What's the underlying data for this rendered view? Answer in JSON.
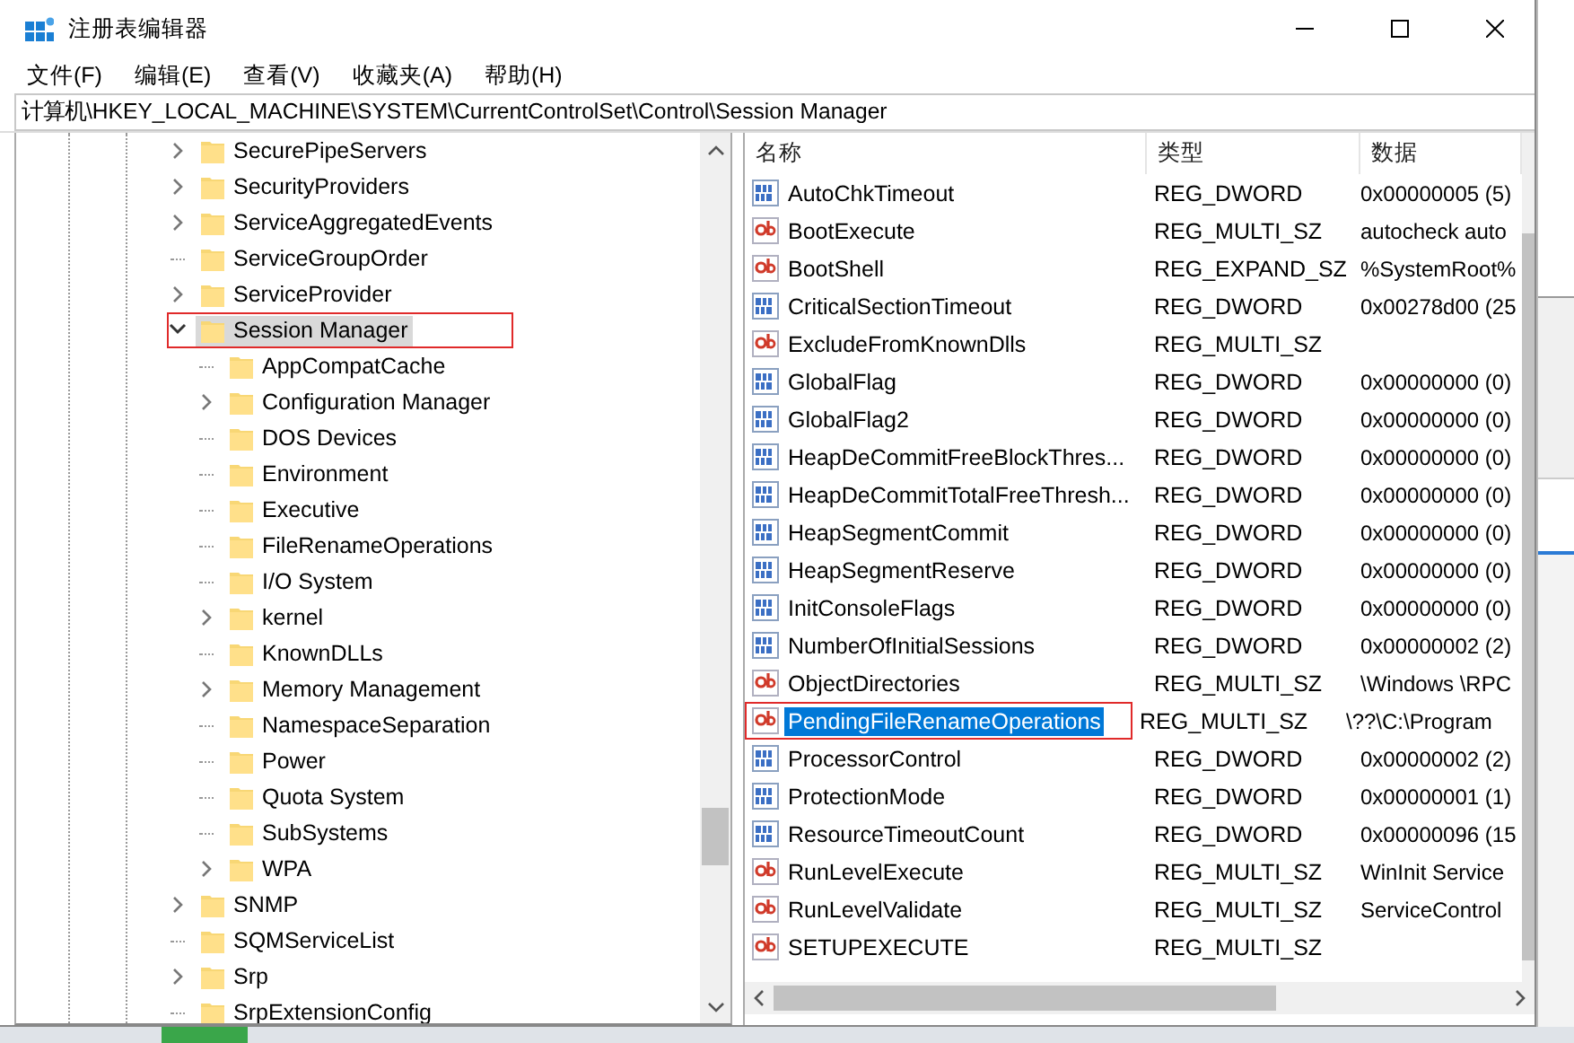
{
  "window": {
    "title": "注册表编辑器"
  },
  "menu": [
    "文件(F)",
    "编辑(E)",
    "查看(V)",
    "收藏夹(A)",
    "帮助(H)"
  ],
  "address_bar": {
    "value": "计算机\\HKEY_LOCAL_MACHINE\\SYSTEM\\CurrentControlSet\\Control\\Session Manager"
  },
  "tree": {
    "items": [
      {
        "label": "SecurePipeServers",
        "expandable": true,
        "expanded": false,
        "selected": false,
        "annotated": false
      },
      {
        "label": "SecurityProviders",
        "expandable": true,
        "expanded": false,
        "selected": false,
        "annotated": false
      },
      {
        "label": "ServiceAggregatedEvents",
        "expandable": true,
        "expanded": false,
        "selected": false,
        "annotated": false
      },
      {
        "label": "ServiceGroupOrder",
        "expandable": false,
        "expanded": false,
        "selected": false,
        "annotated": false
      },
      {
        "label": "ServiceProvider",
        "expandable": true,
        "expanded": false,
        "selected": false,
        "annotated": false
      },
      {
        "label": "Session Manager",
        "expandable": true,
        "expanded": true,
        "selected": true,
        "annotated": true,
        "children": [
          {
            "label": "AppCompatCache",
            "expandable": false,
            "expanded": false,
            "selected": false,
            "annotated": false
          },
          {
            "label": "Configuration Manager",
            "expandable": true,
            "expanded": false,
            "selected": false,
            "annotated": false
          },
          {
            "label": "DOS Devices",
            "expandable": false,
            "expanded": false,
            "selected": false,
            "annotated": false
          },
          {
            "label": "Environment",
            "expandable": false,
            "expanded": false,
            "selected": false,
            "annotated": false
          },
          {
            "label": "Executive",
            "expandable": false,
            "expanded": false,
            "selected": false,
            "annotated": false
          },
          {
            "label": "FileRenameOperations",
            "expandable": false,
            "expanded": false,
            "selected": false,
            "annotated": false
          },
          {
            "label": "I/O System",
            "expandable": false,
            "expanded": false,
            "selected": false,
            "annotated": false
          },
          {
            "label": "kernel",
            "expandable": true,
            "expanded": false,
            "selected": false,
            "annotated": false
          },
          {
            "label": "KnownDLLs",
            "expandable": false,
            "expanded": false,
            "selected": false,
            "annotated": false
          },
          {
            "label": "Memory Management",
            "expandable": true,
            "expanded": false,
            "selected": false,
            "annotated": false
          },
          {
            "label": "NamespaceSeparation",
            "expandable": false,
            "expanded": false,
            "selected": false,
            "annotated": false
          },
          {
            "label": "Power",
            "expandable": false,
            "expanded": false,
            "selected": false,
            "annotated": false
          },
          {
            "label": "Quota System",
            "expandable": false,
            "expanded": false,
            "selected": false,
            "annotated": false
          },
          {
            "label": "SubSystems",
            "expandable": false,
            "expanded": false,
            "selected": false,
            "annotated": false
          },
          {
            "label": "WPA",
            "expandable": true,
            "expanded": false,
            "selected": false,
            "annotated": false
          }
        ]
      },
      {
        "label": "SNMP",
        "expandable": true,
        "expanded": false,
        "selected": false,
        "annotated": false
      },
      {
        "label": "SQMServiceList",
        "expandable": false,
        "expanded": false,
        "selected": false,
        "annotated": false
      },
      {
        "label": "Srp",
        "expandable": true,
        "expanded": false,
        "selected": false,
        "annotated": false
      },
      {
        "label": "SrpExtensionConfig",
        "expandable": false,
        "expanded": false,
        "selected": false,
        "annotated": false
      }
    ]
  },
  "values": {
    "columns": [
      "名称",
      "类型",
      "数据"
    ],
    "rows": [
      {
        "kind": "dword",
        "name": "AutoChkTimeout",
        "type": "REG_DWORD",
        "data": "0x00000005 (5)",
        "selected": false,
        "annotated": false
      },
      {
        "kind": "string",
        "name": "BootExecute",
        "type": "REG_MULTI_SZ",
        "data": "autocheck auto",
        "selected": false,
        "annotated": false
      },
      {
        "kind": "string",
        "name": "BootShell",
        "type": "REG_EXPAND_SZ",
        "data": "%SystemRoot%",
        "selected": false,
        "annotated": false
      },
      {
        "kind": "dword",
        "name": "CriticalSectionTimeout",
        "type": "REG_DWORD",
        "data": "0x00278d00 (25",
        "selected": false,
        "annotated": false
      },
      {
        "kind": "string",
        "name": "ExcludeFromKnownDlls",
        "type": "REG_MULTI_SZ",
        "selected": false,
        "annotated": false
      },
      {
        "kind": "dword",
        "name": "GlobalFlag",
        "type": "REG_DWORD",
        "data": "0x00000000 (0)",
        "selected": false,
        "annotated": false
      },
      {
        "kind": "dword",
        "name": "GlobalFlag2",
        "type": "REG_DWORD",
        "data": "0x00000000 (0)",
        "selected": false,
        "annotated": false
      },
      {
        "kind": "dword",
        "name": "HeapDeCommitFreeBlockThres...",
        "type": "REG_DWORD",
        "data": "0x00000000 (0)",
        "selected": false,
        "annotated": false
      },
      {
        "kind": "dword",
        "name": "HeapDeCommitTotalFreeThresh...",
        "type": "REG_DWORD",
        "data": "0x00000000 (0)",
        "selected": false,
        "annotated": false
      },
      {
        "kind": "dword",
        "name": "HeapSegmentCommit",
        "type": "REG_DWORD",
        "data": "0x00000000 (0)",
        "selected": false,
        "annotated": false
      },
      {
        "kind": "dword",
        "name": "HeapSegmentReserve",
        "type": "REG_DWORD",
        "data": "0x00000000 (0)",
        "selected": false,
        "annotated": false
      },
      {
        "kind": "dword",
        "name": "InitConsoleFlags",
        "type": "REG_DWORD",
        "data": "0x00000000 (0)",
        "selected": false,
        "annotated": false
      },
      {
        "kind": "dword",
        "name": "NumberOfInitialSessions",
        "type": "REG_DWORD",
        "data": "0x00000002 (2)",
        "selected": false,
        "annotated": false
      },
      {
        "kind": "string",
        "name": "ObjectDirectories",
        "type": "REG_MULTI_SZ",
        "data": "\\Windows \\RPC",
        "selected": false,
        "annotated": false
      },
      {
        "kind": "string",
        "name": "PendingFileRenameOperations",
        "type": "REG_MULTI_SZ",
        "data": "\\??\\C:\\Program",
        "selected": true,
        "annotated": true
      },
      {
        "kind": "dword",
        "name": "ProcessorControl",
        "type": "REG_DWORD",
        "data": "0x00000002 (2)",
        "selected": false,
        "annotated": false
      },
      {
        "kind": "dword",
        "name": "ProtectionMode",
        "type": "REG_DWORD",
        "data": "0x00000001 (1)",
        "selected": false,
        "annotated": false
      },
      {
        "kind": "dword",
        "name": "ResourceTimeoutCount",
        "type": "REG_DWORD",
        "data": "0x00000096 (15",
        "selected": false,
        "annotated": false
      },
      {
        "kind": "string",
        "name": "RunLevelExecute",
        "type": "REG_MULTI_SZ",
        "data": "WinInit Service",
        "selected": false,
        "annotated": false
      },
      {
        "kind": "string",
        "name": "RunLevelValidate",
        "type": "REG_MULTI_SZ",
        "data": "ServiceControl",
        "selected": false,
        "annotated": false
      },
      {
        "kind": "string",
        "name": "SETUPEXECUTE",
        "type": "REG_MULTI_SZ",
        "selected": false,
        "annotated": false
      }
    ]
  }
}
